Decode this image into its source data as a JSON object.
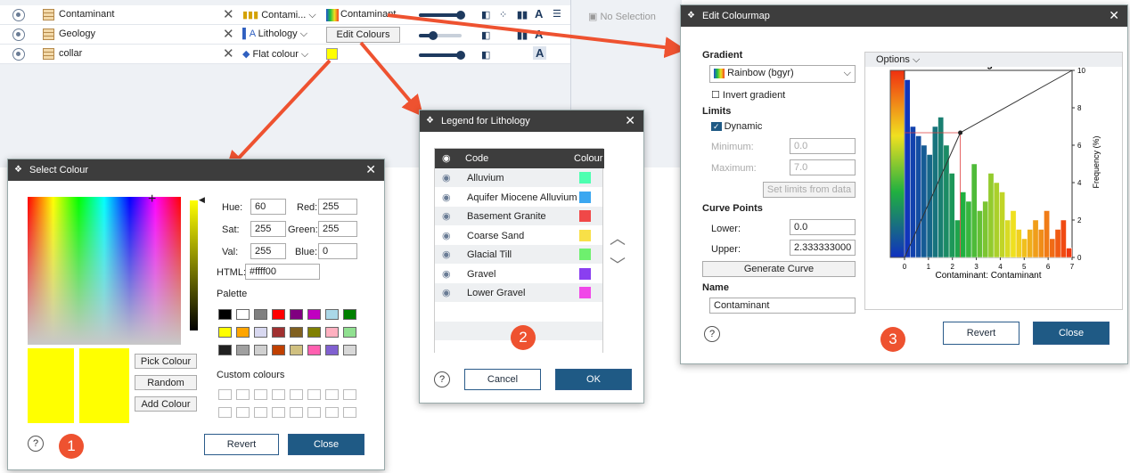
{
  "rows": [
    {
      "name": "Contaminant",
      "selector": "Contami...",
      "value": "Contaminant"
    },
    {
      "name": "Geology",
      "selector": "Lithology",
      "value": "Edit Colours"
    },
    {
      "name": "collar",
      "selector": "Flat colour",
      "value": ""
    }
  ],
  "no_selection": "No Selection",
  "select_colour": {
    "title": "Select Colour",
    "hue_label": "Hue:",
    "hue": "60",
    "sat_label": "Sat:",
    "sat": "255",
    "val_label": "Val:",
    "val": "255",
    "red_label": "Red:",
    "red": "255",
    "green_label": "Green:",
    "green": "255",
    "blue_label": "Blue:",
    "blue": "0",
    "html_label": "HTML:",
    "html": "#ffff00",
    "palette_label": "Palette",
    "custom_label": "Custom colours",
    "pick_colour": "Pick Colour",
    "random": "Random",
    "add_colour": "Add Colour",
    "revert": "Revert",
    "close": "Close",
    "palette": [
      "#000000",
      "#ffffff",
      "#808080",
      "#ff0000",
      "#800080",
      "#c000c0",
      "#aad8e8",
      "#008000",
      "#ffff00",
      "#ffa500",
      "#d8d8f0",
      "#a03030",
      "#806020",
      "#808000",
      "#ffb0c0",
      "#90e090",
      "#202020",
      "#a0a0a0",
      "#d0d0d0",
      "#c04000",
      "#d0c080",
      "#ff60b0",
      "#8060d0",
      "#d8d8d8"
    ]
  },
  "legend": {
    "title": "Legend for Lithology",
    "col_code": "Code",
    "col_colour": "Colour",
    "items": [
      {
        "code": "Alluvium",
        "colour": "#4dffb0"
      },
      {
        "code": "Aquifer Miocene Alluvium",
        "colour": "#3ba7f0"
      },
      {
        "code": "Basement Granite",
        "colour": "#f04848"
      },
      {
        "code": "Coarse Sand",
        "colour": "#f8e048"
      },
      {
        "code": "Glacial Till",
        "colour": "#6ef06e"
      },
      {
        "code": "Gravel",
        "colour": "#8a3ff0"
      },
      {
        "code": "Lower Gravel",
        "colour": "#f048e8"
      }
    ],
    "cancel": "Cancel",
    "ok": "OK"
  },
  "colourmap": {
    "title": "Edit Colourmap",
    "gradient_label": "Gradient",
    "gradient": "Rainbow (bgyr)",
    "invert": "Invert gradient",
    "limits_label": "Limits",
    "dynamic": "Dynamic",
    "minimum_label": "Minimum:",
    "minimum": "0.0",
    "maximum_label": "Maximum:",
    "maximum": "7.0",
    "set_limits": "Set limits from data",
    "curve_label": "Curve Points",
    "lower_label": "Lower:",
    "lower": "0.0",
    "upper_label": "Upper:",
    "upper": "2.333333000",
    "generate": "Generate Curve",
    "name_label": "Name",
    "name": "Contaminant",
    "options": "Options",
    "hist_title": "Histogram",
    "xlabel": "Contaminant: Contaminant",
    "ylabel": "Frequency (%)",
    "xticks": [
      "0",
      "1",
      "2",
      "3",
      "4",
      "5",
      "6",
      "7"
    ],
    "yticks": [
      "0",
      "2",
      "4",
      "6",
      "8",
      "10"
    ],
    "revert": "Revert",
    "close": "Close"
  },
  "badges": [
    "1",
    "2",
    "3"
  ],
  "colors": {
    "accent": "#1f5a85",
    "arrow": "#ee5230",
    "titlebar": "#3d3d3d"
  },
  "chart_data": {
    "type": "bar",
    "title": "Histogram",
    "xlabel": "Contaminant: Contaminant",
    "ylabel": "Frequency (%)",
    "xlim": [
      0,
      7
    ],
    "ylim": [
      0,
      10
    ],
    "bin_width": 0.233,
    "values": [
      9.5,
      7.0,
      6.5,
      6.0,
      5.5,
      7.0,
      7.5,
      6.0,
      4.5,
      2.0,
      3.5,
      3.0,
      5.0,
      2.5,
      3.0,
      4.5,
      4.0,
      3.5,
      2.0,
      2.5,
      1.5,
      1.0,
      1.5,
      2.0,
      1.5,
      2.5,
      1.0,
      1.5,
      2.0,
      0.5
    ]
  }
}
